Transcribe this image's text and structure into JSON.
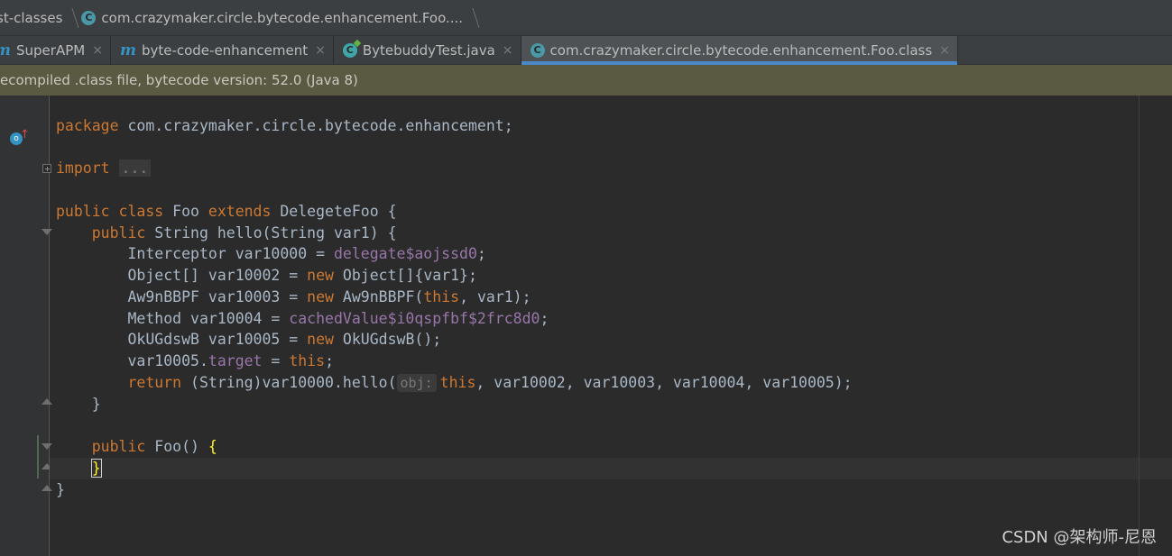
{
  "breadcrumb": {
    "items": [
      "st-classes",
      "com.crazymaker.circle.bytecode.enhancement.Foo...."
    ]
  },
  "tabs": [
    {
      "label": "SuperAPM",
      "icon": "module-m-icon",
      "active": false
    },
    {
      "label": "byte-code-enhancement",
      "icon": "module-m-icon",
      "active": false
    },
    {
      "label": "BytebuddyTest.java",
      "icon": "class-c-icon",
      "active": false
    },
    {
      "label": "com.crazymaker.circle.bytecode.enhancement.Foo.class",
      "icon": "class-c-icon",
      "active": true
    }
  ],
  "tab_close_glyph": "×",
  "notice": "ecompiled .class file, bytecode version: 52.0 (Java 8)",
  "code": {
    "l_package_kw": "package",
    "l_package_rest": " com.crazymaker.circle.bytecode.enhancement;",
    "l_import_kw": "import",
    "l_import_fold": "...",
    "l_class_kw1": "public",
    "l_class_kw2": "class",
    "l_class_name": " Foo ",
    "l_class_kw3": "extends",
    "l_class_rest": " DelegeteFoo {",
    "l_hello_kw": "public",
    "l_hello_rest": " String hello(String var1) {",
    "l_interceptor_a": "Interceptor var10000 = ",
    "l_interceptor_fld": "delegate$aojssd0",
    "l_interceptor_b": ";",
    "l_object_a": "Object[] var10002 = ",
    "l_object_kw": "new",
    "l_object_b": " Object[]{var1};",
    "l_aw_a": "Aw9nBBPF var10003 = ",
    "l_aw_kw": "new",
    "l_aw_b": " Aw9nBBPF(",
    "l_aw_this": "this",
    "l_aw_c": ", var1);",
    "l_method_a": "Method var10004 = ",
    "l_method_fld": "cachedValue$i0qspfbf$2frc8d0",
    "l_method_b": ";",
    "l_ok_a": "OkUGdswB var10005 = ",
    "l_ok_kw": "new",
    "l_ok_b": " OkUGdswB();",
    "l_target_a": "var10005.",
    "l_target_fld": "target",
    "l_target_b": " = ",
    "l_target_this": "this",
    "l_target_c": ";",
    "l_return_kw": "return",
    "l_return_a": " (String)var10000.hello(",
    "l_return_hint": "obj:",
    "l_return_this": "this",
    "l_return_b": ", var10002, var10003, var10004, var10005);",
    "l_close1": "}",
    "l_foo_kw": "public",
    "l_foo_rest": " Foo() ",
    "l_foo_brace": "{",
    "l_foo_close": "}",
    "l_class_close": "}"
  },
  "watermark": "CSDN @架构师-尼恩",
  "colors": {
    "keyword": "#cc7832",
    "field": "#9876aa",
    "text": "#a9b7c6",
    "notice_bg": "#5a5a42",
    "tab_underline": "#4a88c7"
  }
}
